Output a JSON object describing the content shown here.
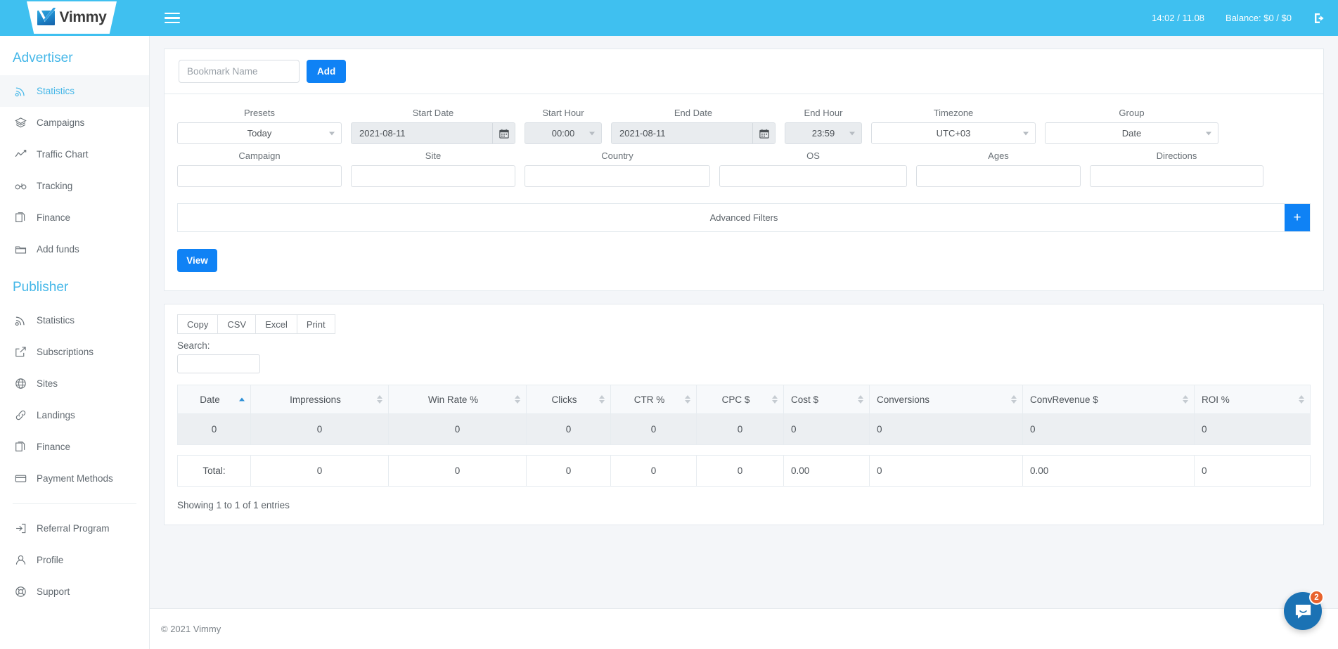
{
  "topbar": {
    "brand": "Vimmy",
    "menu_icon": "hamburger-icon",
    "clock": "14:02 / 11.08",
    "balance": "Balance: $0 / $0",
    "logout_icon": "logout-icon"
  },
  "sidebar": {
    "groups": [
      {
        "title": "Advertiser",
        "items": [
          {
            "label": "Statistics",
            "icon": "rss-icon",
            "active": true
          },
          {
            "label": "Campaigns",
            "icon": "layers-icon",
            "active": false
          },
          {
            "label": "Traffic Chart",
            "icon": "line-chart-icon",
            "active": false
          },
          {
            "label": "Tracking",
            "icon": "glasses-icon",
            "active": false
          },
          {
            "label": "Finance",
            "icon": "file-copy-icon",
            "active": false
          },
          {
            "label": "Add funds",
            "icon": "folder-icon",
            "active": false
          }
        ]
      },
      {
        "title": "Publisher",
        "items": [
          {
            "label": "Statistics",
            "icon": "rss-icon",
            "active": false
          },
          {
            "label": "Subscriptions",
            "icon": "external-link-icon",
            "active": false
          },
          {
            "label": "Sites",
            "icon": "globe-icon",
            "active": false
          },
          {
            "label": "Landings",
            "icon": "link-icon",
            "active": false
          },
          {
            "label": "Finance",
            "icon": "file-copy-icon",
            "active": false
          },
          {
            "label": "Payment Methods",
            "icon": "credit-card-icon",
            "active": false
          }
        ]
      },
      {
        "title": "",
        "items": [
          {
            "label": "Referral Program",
            "icon": "sign-in-icon",
            "active": false
          },
          {
            "label": "Profile",
            "icon": "user-icon",
            "active": false
          },
          {
            "label": "Support",
            "icon": "life-ring-icon",
            "active": false
          }
        ]
      }
    ]
  },
  "bookmark": {
    "placeholder": "Bookmark Name",
    "value": "",
    "add_label": "Add"
  },
  "filters": {
    "row1": [
      {
        "label": "Presets",
        "type": "select",
        "value": "Today"
      },
      {
        "label": "Start Date",
        "type": "date",
        "value": "2021-08-11",
        "icon": "calendar-icon"
      },
      {
        "label": "Start Hour",
        "type": "hour",
        "value": "00:00"
      },
      {
        "label": "End Date",
        "type": "date",
        "value": "2021-08-11",
        "icon": "calendar-icon"
      },
      {
        "label": "End Hour",
        "type": "hour",
        "value": "23:59"
      },
      {
        "label": "Timezone",
        "type": "select",
        "value": "UTC+03"
      },
      {
        "label": "Group",
        "type": "select",
        "value": "Date"
      }
    ],
    "row2": [
      {
        "label": "Campaign",
        "value": ""
      },
      {
        "label": "Site",
        "value": ""
      },
      {
        "label": "Country",
        "value": ""
      },
      {
        "label": "OS",
        "value": ""
      },
      {
        "label": "Ages",
        "value": ""
      },
      {
        "label": "Directions",
        "value": ""
      }
    ],
    "advanced_label": "Advanced Filters",
    "advanced_plus": "+",
    "view_label": "View"
  },
  "table_toolbar": {
    "export_buttons": [
      "Copy",
      "CSV",
      "Excel",
      "Print"
    ],
    "search_label": "Search:",
    "search_value": ""
  },
  "table": {
    "columns": [
      {
        "label": "Date",
        "sort": "asc",
        "align": "center"
      },
      {
        "label": "Impressions",
        "sort": "none",
        "align": "center"
      },
      {
        "label": "Win Rate %",
        "sort": "none",
        "align": "center"
      },
      {
        "label": "Clicks",
        "sort": "none",
        "align": "center"
      },
      {
        "label": "CTR %",
        "sort": "none",
        "align": "center"
      },
      {
        "label": "CPC $",
        "sort": "none",
        "align": "center"
      },
      {
        "label": "Cost $",
        "sort": "none",
        "align": "left"
      },
      {
        "label": "Conversions",
        "sort": "none",
        "align": "left"
      },
      {
        "label": "ConvRevenue $",
        "sort": "none",
        "align": "left"
      },
      {
        "label": "ROI %",
        "sort": "none",
        "align": "left"
      }
    ],
    "rows": [
      {
        "cells": [
          "0",
          "0",
          "0",
          "0",
          "0",
          "0",
          "0",
          "0",
          "0",
          "0"
        ]
      }
    ],
    "total_label": "Total:",
    "total_cells": [
      "0",
      "0",
      "0",
      "0",
      "0",
      "0.00",
      "0",
      "0.00",
      "0"
    ],
    "showing": "Showing 1 to 1 of 1 entries"
  },
  "footer": {
    "copyright": "© 2021 Vimmy"
  },
  "intercom": {
    "badge": "2",
    "icon": "chat-bubble-icon"
  },
  "colors": {
    "topbar": "#3fc0f0",
    "accent_blue": "#0f82f5",
    "sidebar_link_active": "#45b7e8",
    "intercom": "#1b72b4",
    "badge": "#e8622c"
  }
}
